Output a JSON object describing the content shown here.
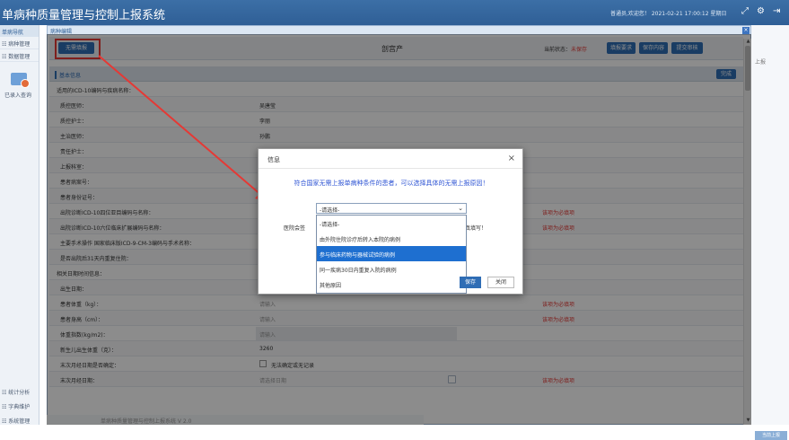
{
  "app": {
    "title": "单病种质量管理与控制上报系统",
    "user_info": "普通员,欢迎您！ 2021-02-21 17:00:12 星期日"
  },
  "sidebar": {
    "header": "单病导航",
    "items": [
      "病种管理",
      "数据管理"
    ],
    "sub_label": "已录入查询",
    "bottom_items": [
      "统计分析",
      "字典维护",
      "系统管理"
    ]
  },
  "window": {
    "tab_title": "病种编辑",
    "close": "×"
  },
  "toolbar": {
    "no_report_button": "无需填报",
    "doc_title": "剖宫产",
    "state_label": "当前状态：",
    "state_value": "未保存",
    "fill_req_button": "填报要求",
    "save_button": "保存内容",
    "submit_button": "提交审核"
  },
  "section": {
    "title": "基本信息",
    "fold_button": "完成"
  },
  "form_rows": [
    {
      "label": "适用的ICD-10编码与疾病名称：",
      "value": "",
      "indent": false
    },
    {
      "label": "质控医师：",
      "value": "吴唐莹",
      "indent": true
    },
    {
      "label": "质控护士：",
      "value": "李丽",
      "indent": true
    },
    {
      "label": "主治医师：",
      "value": "孙鹏",
      "indent": true
    },
    {
      "label": "责任护士：",
      "value": "",
      "indent": true
    },
    {
      "label": "上报科室：",
      "value": "",
      "indent": true
    },
    {
      "label": "患者病案号：",
      "value": "",
      "indent": true
    },
    {
      "label": "患者身份证号：",
      "value": "",
      "indent": true
    },
    {
      "label": "出院诊断ICD-10四位亚目编码与名称：",
      "value": "",
      "indent": true,
      "req": "该项为必填项"
    },
    {
      "label": "出院诊断ICD-10六位临床扩展编码与名称：",
      "value": "",
      "indent": true,
      "req": "该项为必填项"
    },
    {
      "label": "主要手术操作 国家临床版ICD-9-CM-3编码与手术名称：",
      "value": "",
      "indent": true
    },
    {
      "label": "是否出院后31天内重复住院：",
      "value": "",
      "indent": true
    },
    {
      "label": "相关日期时间信息：",
      "value": "",
      "indent": false
    },
    {
      "label": "出生日期：",
      "value": "1994-04-28",
      "indent": true,
      "cal": true
    },
    {
      "label": "患者体重（kg）：",
      "value": "请输入",
      "indent": true,
      "ph": true,
      "req": "该项为必填项"
    },
    {
      "label": "患者身高（cm）：",
      "value": "请输入",
      "indent": true,
      "ph": true,
      "req": "该项为必填项"
    },
    {
      "label": "体重指数(kg/m2)：",
      "value": "请输入",
      "indent": true,
      "ph": true,
      "grey": true
    },
    {
      "label": "新生儿出生体重（克）：",
      "value": "3260",
      "indent": true
    },
    {
      "label": "末次月经日期是否确定：",
      "value": "无法确定或无记录",
      "indent": true,
      "chk": true
    },
    {
      "label": "末次月经日期：",
      "value": "请选择日期",
      "indent": true,
      "ph": true,
      "cal": true,
      "req": "该项为必填项"
    }
  ],
  "modal": {
    "title": "信息",
    "close": "×",
    "message": "符合国家无需上报单病种条件的患者，可以选择具体的无需上报原因！",
    "reason_label": "医院会签",
    "reason_note": "真填写！",
    "select_value": "-请选择-",
    "options": [
      "-请选择-",
      "由外院住院诊疗后转入本院的病例",
      "参与临床药物与器械试验的病例",
      "同一疾病30日内重复入院的病例",
      "其他原因"
    ],
    "selected_index": 2,
    "save_button": "保存",
    "close_button": "关闭"
  },
  "right_strip": {
    "label": "上报",
    "bottom_button": "当前上报"
  },
  "pager": "单病种质量管理与控制上报系统 V 2.0"
}
